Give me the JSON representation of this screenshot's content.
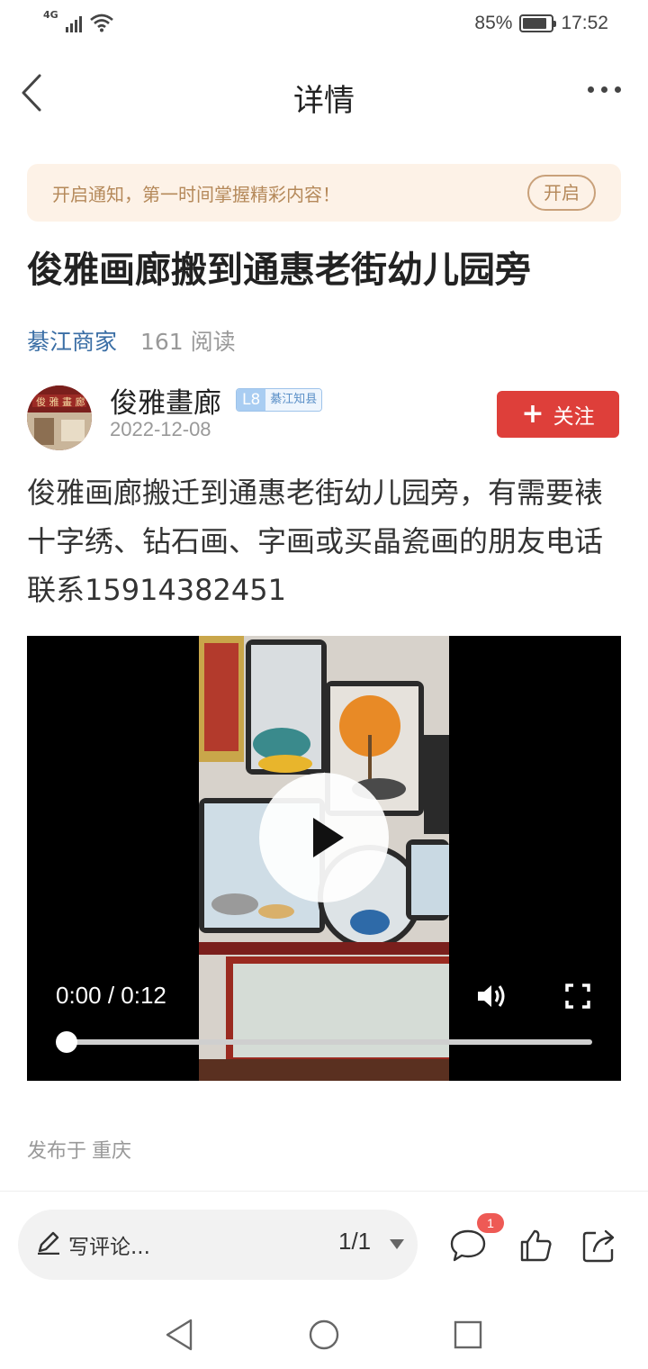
{
  "status_bar": {
    "network": "4G",
    "battery": "85%",
    "battery_level": 0.85,
    "time": "17:52"
  },
  "nav": {
    "title": "详情"
  },
  "notice": {
    "text": "开启通知，第一时间掌握精彩内容！",
    "button": "开启"
  },
  "article": {
    "title": "俊雅画廊搬到通惠老街幼儿园旁",
    "source": "綦江商家",
    "reads": "161 阅读",
    "author": {
      "name": "俊雅畫廊",
      "level": "L8",
      "badge": "綦江知县",
      "date": "2022-12-08",
      "follow_label": "关注"
    },
    "body": "俊雅画廊搬迁到通惠老街幼儿园旁，有需要裱十字绣、钻石画、字画或买晶瓷画的朋友电话联系15914382451",
    "video": {
      "time": "0:00 / 0:12",
      "progress": 0.0
    },
    "location_prefix": "发布于",
    "location": "重庆"
  },
  "bottom_bar": {
    "comment_placeholder": "写评论...",
    "page": "1/1",
    "comment_count": "1"
  },
  "colors": {
    "accent_red": "#de3f3a",
    "link_blue": "#3a6ea5",
    "notice_bg": "#fdf2e7",
    "notice_text": "#b5895a"
  },
  "icons": [
    "back-icon",
    "more-icon",
    "play-icon",
    "volume-icon",
    "fullscreen-icon",
    "pen-icon",
    "comment-icon",
    "like-icon",
    "share-icon",
    "sys-back-icon",
    "sys-home-icon",
    "sys-recent-icon"
  ]
}
